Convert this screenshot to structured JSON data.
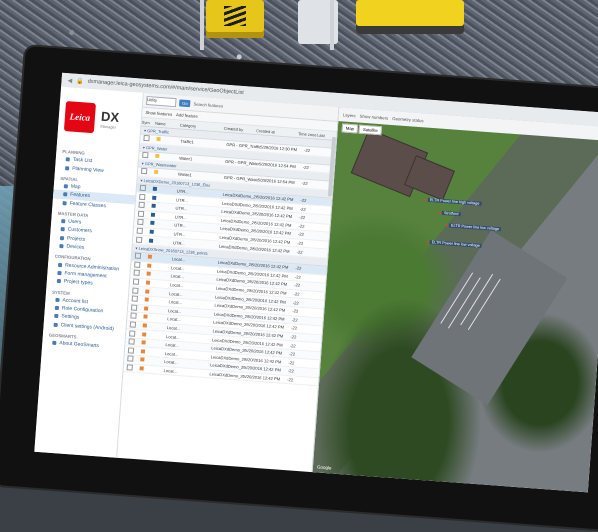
{
  "browser": {
    "url": "dxmanager.leica-geosystems.com/#/main/service/GeoObjectList"
  },
  "brand": {
    "logo_text": "Leica",
    "logo_sub": "Geosystems",
    "product": "DX",
    "product_sub": "Manager"
  },
  "nav": {
    "sections": [
      {
        "title": "Planning",
        "items": [
          "Task List",
          "Planning View"
        ]
      },
      {
        "title": "Spatial",
        "items": [
          "Map",
          "Features",
          "Feature Classes"
        ]
      },
      {
        "title": "Master Data",
        "items": [
          "Users",
          "Customers",
          "Projects",
          "Devices"
        ]
      },
      {
        "title": "Configuration",
        "items": [
          "Resource Administration",
          "Form management",
          "Project types"
        ]
      },
      {
        "title": "System",
        "items": [
          "Account list",
          "Role Configuration",
          "Settings",
          "Client settings (Android)"
        ]
      },
      {
        "title": "GeoSmarts",
        "items": [
          "About GeoSmarts"
        ]
      }
    ],
    "active": "Features"
  },
  "toolbar": {
    "search_value": "Utility",
    "btn_label": "Go",
    "search_features_placeholder": "Search features",
    "new_layer": "Show features",
    "actions": "Add feature"
  },
  "table": {
    "headers": [
      "Sym",
      "Name",
      "Category",
      "Created by",
      "Created at",
      "Time zone",
      "Last"
    ],
    "groups": [
      {
        "label": "GPR_Traffic",
        "rows": [
          {
            "name": "Traffic1",
            "cat": "GPR - GPR_Traffic",
            "date": "5/29/2016 12:30 PM",
            "color": "#f2c14a"
          }
        ]
      },
      {
        "label": "GPR_Water",
        "rows": [
          {
            "name": "Water1",
            "cat": "GPR - GPR_Water",
            "date": "5/29/2016 12:54 PM",
            "color": "#f2c14a"
          }
        ]
      },
      {
        "label": "GPR_Wastewater",
        "rows": [
          {
            "name": "Waste1",
            "cat": "GPR - GPR_Waste",
            "date": "5/29/2016 12:54 PM",
            "color": "#f2c14a"
          }
        ]
      },
      {
        "label": "LeicaDXDemo_20160713_1236_Elec",
        "rows": [
          {
            "name": "UTR...",
            "cat": "LeicaDXdDemo_20160713...",
            "date": "5/20/2016 12:42 PM",
            "color": "#2b5d92"
          },
          {
            "name": "UTR...",
            "cat": "LeicaDXdDemo_20160713...",
            "date": "5/20/2016 12:42 PM",
            "color": "#2b5d92"
          },
          {
            "name": "UTR...",
            "cat": "LeicaDXdDemo_20160713...",
            "date": "5/20/2016 12:42 PM",
            "color": "#2b5d92"
          },
          {
            "name": "UTR...",
            "cat": "LeicaDXdDemo_20160713...",
            "date": "5/20/2016 12:42 PM",
            "color": "#2b5d92"
          },
          {
            "name": "UTR...",
            "cat": "LeicaDXdDemo_20160713...",
            "date": "5/20/2016 12:42 PM",
            "color": "#2b5d92"
          },
          {
            "name": "UTR...",
            "cat": "LeicaDXdDemo_20160713...",
            "date": "5/20/2016 12:42 PM",
            "color": "#2b5d92"
          },
          {
            "name": "UTR...",
            "cat": "LeicaDXdDemo_20160713...",
            "date": "5/20/2016 12:42 PM",
            "color": "#2b5d92"
          }
        ]
      },
      {
        "label": "LeicaDXSnow_20160713_1236_points",
        "rows": [
          {
            "name": "Locat...",
            "cat": "LeicaDXdDemo_20160713...",
            "date": "5/20/2016 12:42 PM",
            "color": "#e6873a"
          },
          {
            "name": "Locat...",
            "cat": "LeicaDXdDemo_20160713...",
            "date": "5/20/2016 12:42 PM",
            "color": "#e6873a"
          },
          {
            "name": "Locat...",
            "cat": "LeicaDXdDemo_20160713...",
            "date": "5/20/2016 12:42 PM",
            "color": "#e6873a"
          },
          {
            "name": "Locat...",
            "cat": "LeicaDXdDemo_20160713...",
            "date": "5/20/2016 12:42 PM",
            "color": "#e6873a"
          },
          {
            "name": "Locat...",
            "cat": "LeicaDXdDemo_20160713...",
            "date": "5/20/2016 12:42 PM",
            "color": "#e6873a"
          },
          {
            "name": "Locat...",
            "cat": "LeicaDXdDemo_20160713...",
            "date": "5/20/2016 12:42 PM",
            "color": "#e6873a"
          },
          {
            "name": "Locat...",
            "cat": "LeicaDXdDemo_20160713...",
            "date": "5/20/2016 12:42 PM",
            "color": "#e6873a"
          },
          {
            "name": "Locat...",
            "cat": "LeicaDXdDemo_20160713...",
            "date": "5/20/2016 12:42 PM",
            "color": "#e6873a"
          },
          {
            "name": "Locat...",
            "cat": "LeicaDXdDemo_20160713...",
            "date": "5/20/2016 12:42 PM",
            "color": "#e6873a"
          },
          {
            "name": "Locat...",
            "cat": "LeicaDXdDemo_20160713...",
            "date": "5/20/2016 12:42 PM",
            "color": "#e6873a"
          },
          {
            "name": "Locat...",
            "cat": "LeicaDXdDemo_20160713...",
            "date": "5/20/2016 12:42 PM",
            "color": "#e6873a"
          },
          {
            "name": "Locat...",
            "cat": "LeicaDXdDemo_20160713...",
            "date": "5/20/2016 12:42 PM",
            "color": "#e6873a"
          },
          {
            "name": "Locat...",
            "cat": "LeicaDXdDemo_20160713...",
            "date": "5/20/2016 12:42 PM",
            "color": "#e6873a"
          },
          {
            "name": "Locat...",
            "cat": "LeicaDXdDemo_20160713...",
            "date": "5/20/2016 12:42 PM",
            "color": "#e6873a"
          }
        ]
      }
    ],
    "row_suffix": "-22"
  },
  "map": {
    "header": [
      "Layers",
      "Show numbers",
      "Geometry status"
    ],
    "tabs": [
      "Map",
      "Satellite"
    ],
    "labels": [
      "ELTR Power line high voltage",
      "Stratford",
      "ELTR Power line low voltage",
      "ELTR Power line low voltage"
    ],
    "footer": "Google"
  }
}
